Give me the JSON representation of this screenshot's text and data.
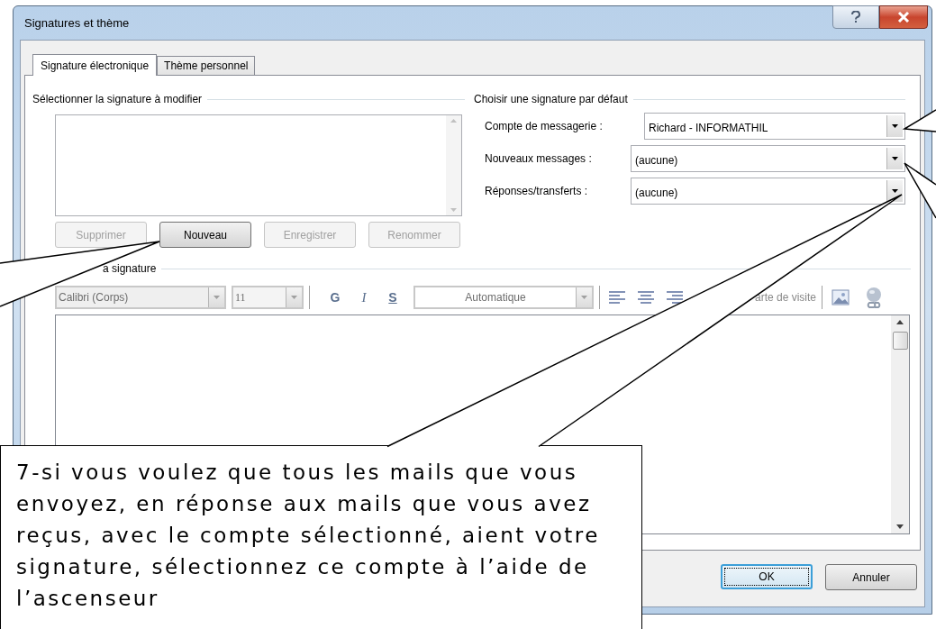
{
  "window": {
    "title": "Signatures et thème"
  },
  "tabs": [
    {
      "label": "Signature électronique",
      "selected": true
    },
    {
      "label": "Thème personnel",
      "selected": false
    }
  ],
  "select_signature": {
    "heading": "Sélectionner la signature à modifier",
    "buttons": [
      {
        "label": "Supprimer",
        "disabled": true
      },
      {
        "label": "Nouveau",
        "disabled": false
      },
      {
        "label": "Enregistrer",
        "disabled": true
      },
      {
        "label": "Renommer",
        "disabled": true
      }
    ]
  },
  "default_signature": {
    "heading": "Choisir une signature par défaut",
    "fields": [
      {
        "label": "Compte de messagerie :",
        "value": "Richard - INFORMATHIL"
      },
      {
        "label": "Nouveaux messages :",
        "value": "(aucune)"
      },
      {
        "label": "Réponses/transferts :",
        "value": "(aucune)"
      }
    ]
  },
  "edit_signature": {
    "heading": "a signature",
    "font": "Calibri (Corps)",
    "size": "11",
    "bold": "G",
    "italic": "I",
    "underline": "S",
    "text_color_setting": "Automatique",
    "business_card": "arte de visite"
  },
  "buttons": [
    {
      "label": "OK",
      "default": true
    },
    {
      "label": "Annuler",
      "default": false
    }
  ],
  "callout": {
    "text": "7-si vous voulez que tous les mails que vous envoyez, en réponse aux mails que vous avez reçus, avec le compte sélectionné,  aient votre signature, sélectionnez ce compte à l’aide de l’ascenseur"
  }
}
